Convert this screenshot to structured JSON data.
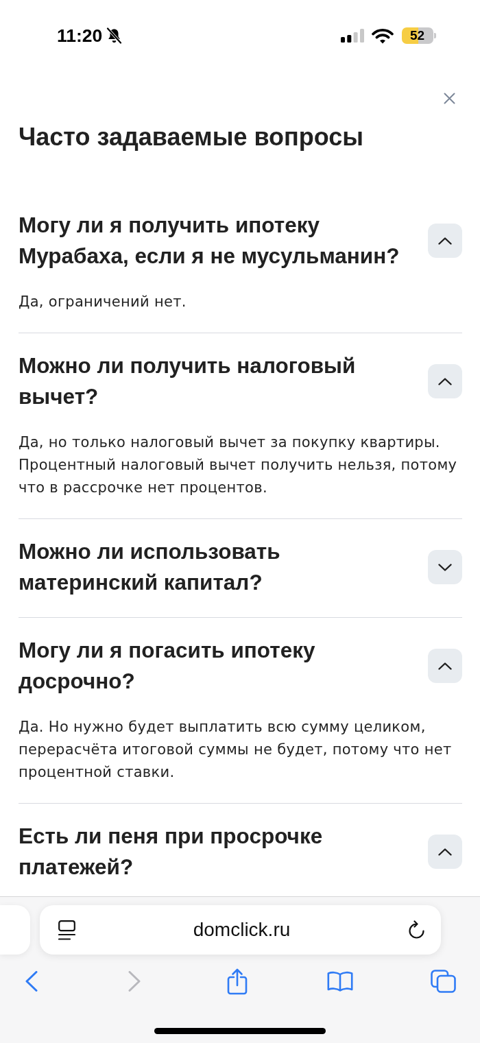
{
  "status_bar": {
    "time": "11:20",
    "battery": "52"
  },
  "sheet": {
    "title": "Часто задаваемые вопросы"
  },
  "faq": [
    {
      "question": "Могу ли я получить ипотеку Мурабаха, если я не мусульманин?",
      "answer": "Да, ограничений нет.",
      "expanded": true
    },
    {
      "question": "Можно ли получить налоговый вычет?",
      "answer": "Да, но только налоговый вычет за покупку квартиры. Процентный налоговый вычет получить нельзя, потому что в рассрочке нет процентов.",
      "expanded": true
    },
    {
      "question": "Можно ли использовать материнский капитал?",
      "expanded": false
    },
    {
      "question": "Могу ли я погасить ипотеку досрочно?",
      "answer": "Да. Но нужно будет выплатить всю сумму целиком, перерасчёта итоговой суммы не будет, потому что нет процентной ставки.",
      "expanded": true
    },
    {
      "question": "Есть ли пеня при просрочке платежей?",
      "expanded": true
    }
  ],
  "browser": {
    "url": "domclick.ru",
    "back_disabled": false,
    "forward_disabled": true
  }
}
